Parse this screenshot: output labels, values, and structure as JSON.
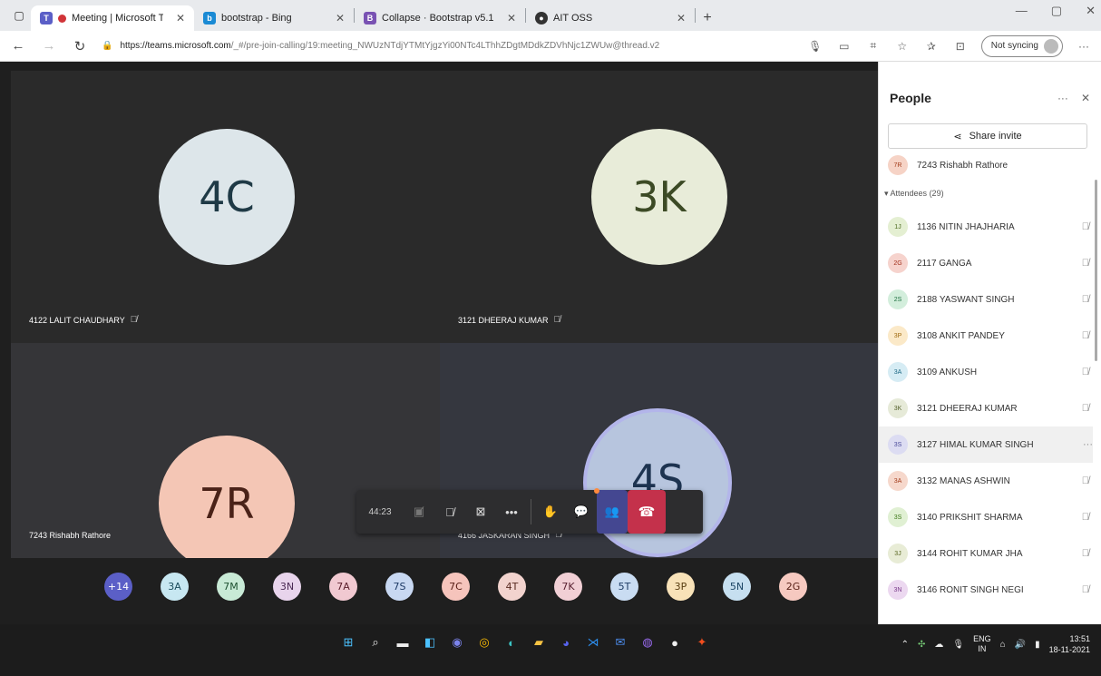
{
  "browser": {
    "tabs": [
      {
        "label": "Meeting | Microsoft Teams",
        "icon": "teams-icon",
        "active": true
      },
      {
        "label": "bootstrap - Bing",
        "icon": "bing-icon",
        "active": false
      },
      {
        "label": "Collapse · Bootstrap v5.1",
        "icon": "bootstrap-icon",
        "active": false
      },
      {
        "label": "AIT OSS",
        "icon": "ait-icon",
        "active": false
      }
    ],
    "url_host": "https://teams.microsoft.com",
    "url_path": "/_#/pre-join-calling/19:meeting_NWUzNTdjYTMtYjgzYi00NTc4LThhZDgtMDdkZDVhNjc1ZWUw@thread.v2",
    "sync_label": "Not syncing"
  },
  "tiles": [
    {
      "initials": "4C",
      "name": "4122 LALIT CHAUDHARY",
      "bg": "#dde6ea",
      "fg": "#1f3a46"
    },
    {
      "initials": "3K",
      "name": "3121 DHEERAJ KUMAR",
      "bg": "#e8ecd9",
      "fg": "#3c4a25"
    },
    {
      "initials": "7R",
      "name": "7243 Rishabh Rathore",
      "bg": "#f4c6b5",
      "fg": "#4a2218"
    },
    {
      "initials": "4S",
      "name": "4166 JASKARAN SINGH",
      "bg": "#b7c5de",
      "fg": "#1d3350"
    }
  ],
  "controls": {
    "timer": "44:23"
  },
  "strip": [
    {
      "label": "+14",
      "bg": "#5b5fc7",
      "fg": "#ffffff"
    },
    {
      "label": "3A",
      "bg": "#c7e7f1",
      "fg": "#1a4c5c"
    },
    {
      "label": "7M",
      "bg": "#c8ead6",
      "fg": "#1d5030"
    },
    {
      "label": "3N",
      "bg": "#e8d4ec",
      "fg": "#4b2a55"
    },
    {
      "label": "7A",
      "bg": "#f1c9d1",
      "fg": "#5a1d2b"
    },
    {
      "label": "7S",
      "bg": "#c8d8f2",
      "fg": "#1f3b66"
    },
    {
      "label": "7C",
      "bg": "#f6c4bc",
      "fg": "#5a2018"
    },
    {
      "label": "4T",
      "bg": "#f2d3ce",
      "fg": "#5a2b22"
    },
    {
      "label": "7K",
      "bg": "#f1cfd5",
      "fg": "#5a2232"
    },
    {
      "label": "5T",
      "bg": "#c9dcf2",
      "fg": "#1f3d66"
    },
    {
      "label": "3P",
      "bg": "#f8e2b8",
      "fg": "#5a3e12"
    },
    {
      "label": "5N",
      "bg": "#c6dff0",
      "fg": "#1d4666"
    },
    {
      "label": "2G",
      "bg": "#f6c9c0",
      "fg": "#5a2218"
    }
  ],
  "panel": {
    "title": "People",
    "share_label": "Share invite",
    "organizer": {
      "initials": "7R",
      "name": "7243 Rishabh Rathore",
      "bg": "#f6d3c6",
      "fg": "#a33d1c"
    },
    "attendees_header": "Attendees (29)",
    "attendees": [
      {
        "initials": "1J",
        "name": "1136 NITIN JHAJHARIA",
        "bg": "#e4efd2",
        "fg": "#4c6b1f"
      },
      {
        "initials": "2G",
        "name": "2117 GANGA",
        "bg": "#f6d3cd",
        "fg": "#a3301c"
      },
      {
        "initials": "2S",
        "name": "2188 YASWANT SINGH",
        "bg": "#d3eedc",
        "fg": "#1f7040"
      },
      {
        "initials": "3P",
        "name": "3108 ANKIT PANDEY",
        "bg": "#fbe9c8",
        "fg": "#a06a10"
      },
      {
        "initials": "3A",
        "name": "3109 ANKUSH",
        "bg": "#d6ecf4",
        "fg": "#1f6a86"
      },
      {
        "initials": "3K",
        "name": "3121 DHEERAJ KUMAR",
        "bg": "#e6ead8",
        "fg": "#56622d"
      },
      {
        "initials": "3S",
        "name": "3127 HIMAL KUMAR SINGH",
        "bg": "#dcdcf2",
        "fg": "#4b4b9a",
        "selected": true
      },
      {
        "initials": "3A",
        "name": "3132 MANAS ASHWIN",
        "bg": "#f6d8cc",
        "fg": "#a33d1c"
      },
      {
        "initials": "3S",
        "name": "3140 PRIKSHIT SHARMA",
        "bg": "#e0f0d3",
        "fg": "#3f7a1a"
      },
      {
        "initials": "3J",
        "name": "3144 ROHIT KUMAR JHA",
        "bg": "#e8ecd6",
        "fg": "#586620"
      },
      {
        "initials": "3N",
        "name": "3146 RONIT SINGH NEGI",
        "bg": "#ecd8f0",
        "fg": "#7a3a8a"
      }
    ]
  },
  "taskbar": {
    "lang_top": "ENG",
    "lang_bottom": "IN",
    "time": "13:51",
    "date": "18-11-2021"
  }
}
